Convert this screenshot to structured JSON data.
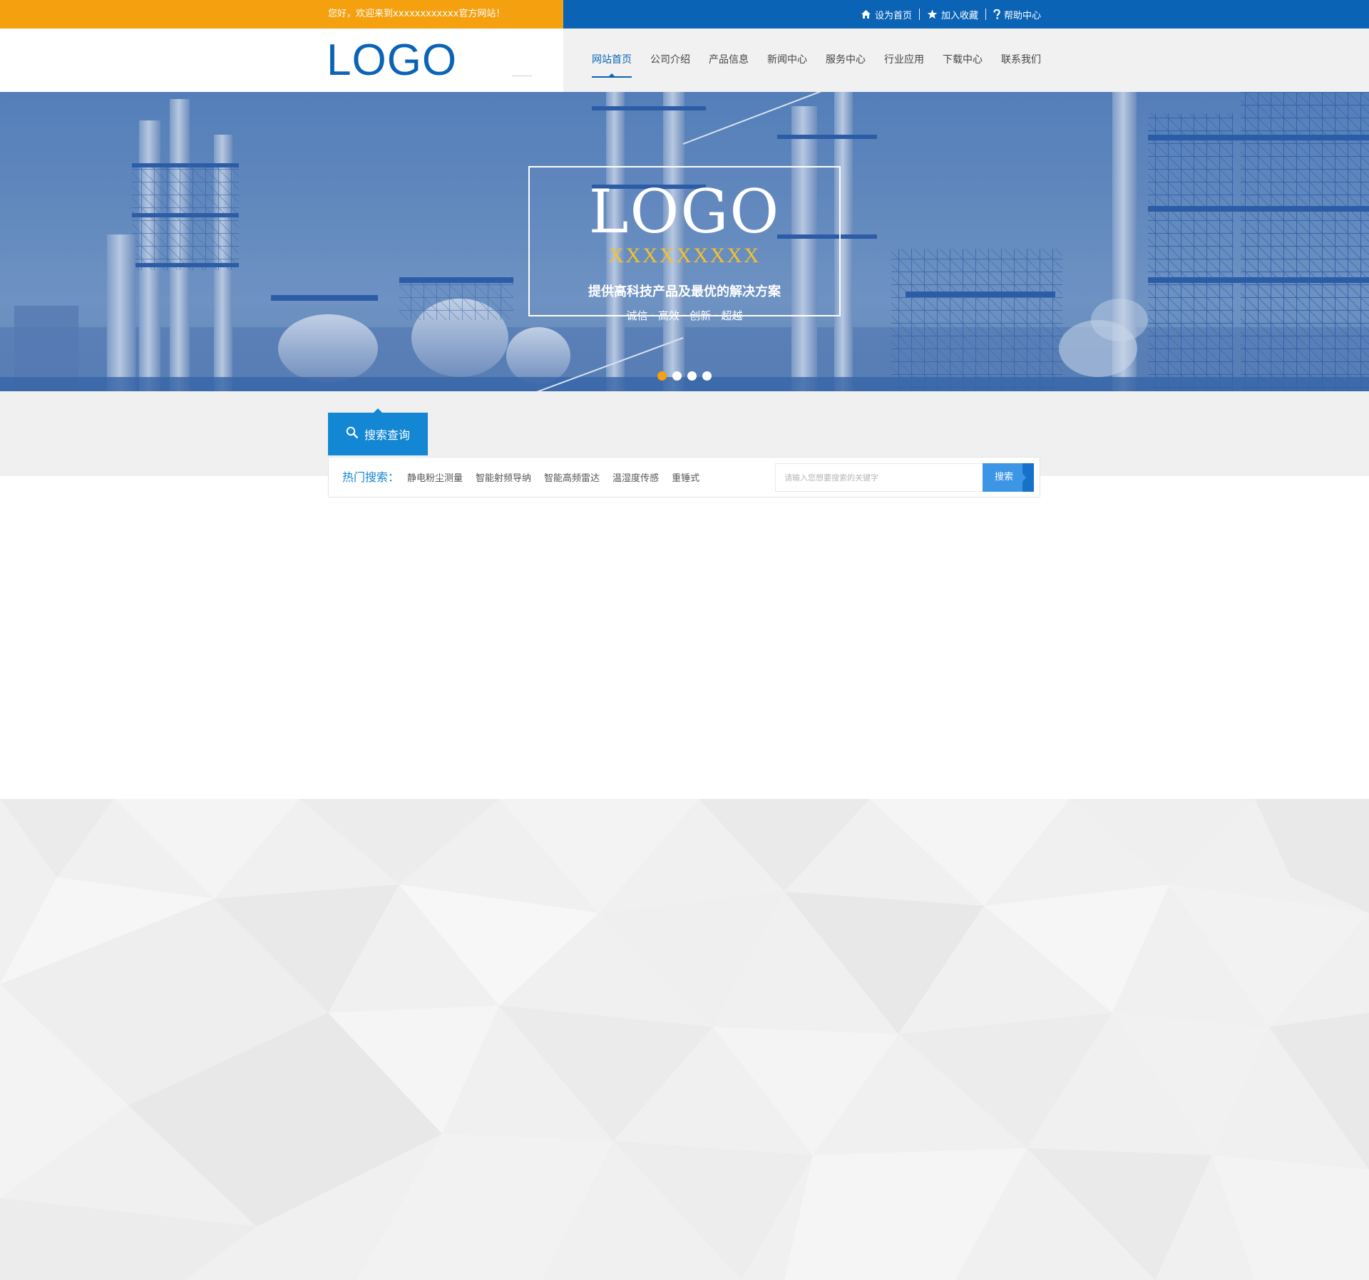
{
  "topbar": {
    "welcome": "您好，欢迎来到xxxxxxxxxxxx官方网站！",
    "links": [
      {
        "label": "设为首页",
        "icon": "home-icon"
      },
      {
        "label": "加入收藏",
        "icon": "star-icon"
      },
      {
        "label": "帮助中心",
        "icon": "question-icon"
      }
    ]
  },
  "header": {
    "logo": "LOGO",
    "nav": [
      "网站首页",
      "公司介绍",
      "产品信息",
      "新闻中心",
      "服务中心",
      "行业应用",
      "下载中心",
      "联系我们"
    ],
    "active_index": 0
  },
  "banner": {
    "logo": "LOGO",
    "sub": "XXXXXXXXX",
    "slogan": "提供高科技产品及最优的解决方案",
    "values": "诚信 · 高效 · 创新 · 超越",
    "slides": 4,
    "active_slide": 0
  },
  "search": {
    "tab_label": "搜索查询",
    "hot_label": "热门搜索：",
    "hot_keywords": [
      "静电粉尘测量",
      "智能射频导纳",
      "智能高频雷达",
      "温湿度传感",
      "重锤式"
    ],
    "placeholder": "请输入您想要搜索的关键字",
    "button": "搜索"
  },
  "colors": {
    "orange": "#f4a00f",
    "brand_blue": "#0b63b6",
    "search_blue": "#1386d4",
    "banner_sub_gold": "#f6c12a"
  }
}
